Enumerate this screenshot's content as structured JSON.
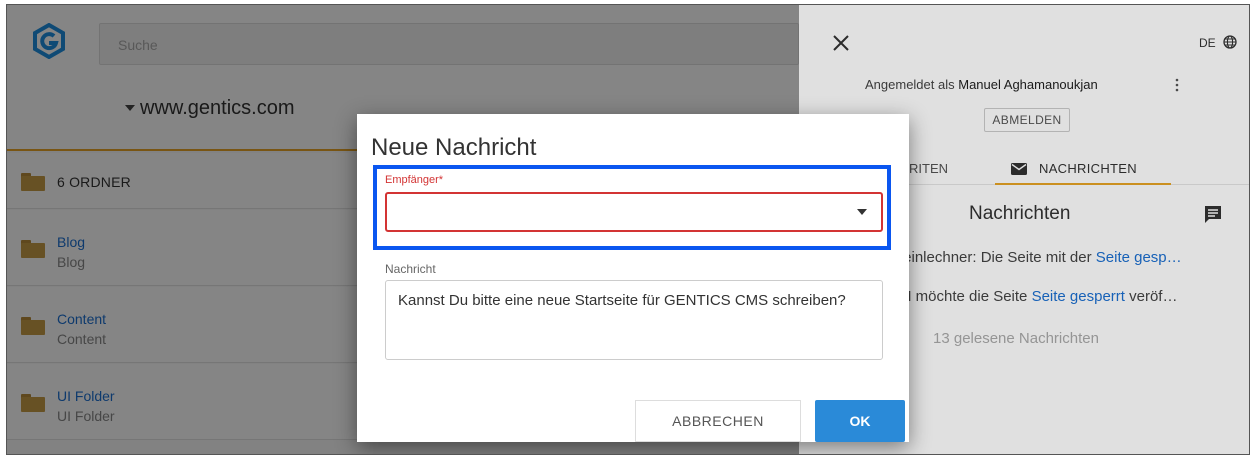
{
  "search": {
    "placeholder": "Suche"
  },
  "node": {
    "name": "www.gentics.com"
  },
  "folders": {
    "header": "6 ORDNER",
    "items": [
      {
        "name": "Blog",
        "sub": "Blog"
      },
      {
        "name": "Content",
        "sub": "Content"
      },
      {
        "name": "UI Folder",
        "sub": "UI Folder"
      }
    ]
  },
  "panel": {
    "language": "DE",
    "logged_in_prefix": "Angemeldet als",
    "user_name": "Manuel Aghamanoukjan",
    "logout_label": "ABMELDEN",
    "tab_favorites_partial": "RITEN",
    "tab_messages": "NACHRICHTEN",
    "messages_title": "Nachrichten",
    "message1_text": "teinlechner: Die Seite mit der ",
    "message1_link": "Seite gesp…",
    "message2_text": "M möchte die Seite ",
    "message2_link": "Seite gesperrt",
    "message2_tail": " veröf…",
    "read_count": "13 gelesene Nachrichten"
  },
  "dialog": {
    "title": "Neue Nachricht",
    "recipient_label": "Empfänger*",
    "recipient_value": "",
    "message_label": "Nachricht",
    "message_value": "Kannst Du bitte eine neue Startseite für GENTICS CMS schreiben?",
    "cancel_label": "ABBRECHEN",
    "ok_label": "OK"
  },
  "colors": {
    "accent": "#e8a425",
    "link": "#1b6fd1",
    "error": "#d33434",
    "primary_button": "#2a8ad8",
    "highlight_box": "#0a56f0"
  }
}
